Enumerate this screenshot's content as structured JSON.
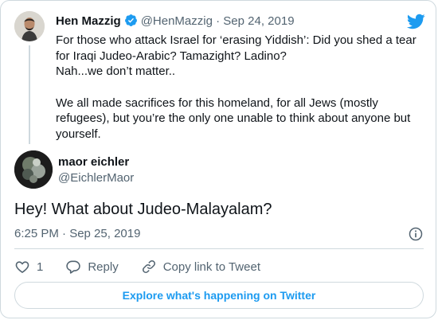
{
  "quoted_tweet": {
    "author_name": "Hen Mazzig",
    "author_handle": "@HenMazzig",
    "separator": "·",
    "date": "Sep 24, 2019",
    "lines": [
      "For those who attack Israel for ‘erasing Yiddish’: Did you shed a tear for Iraqi Judeo-Arabic? Tamazight? Ladino?",
      "Nah...we don’t matter..",
      "We all made sacrifices for this homeland, for all Jews (mostly refugees), but you’re the only one unable to think about anyone but yourself."
    ]
  },
  "reply_tweet": {
    "author_name": "maor eichler",
    "author_handle": "@EichlerMaor",
    "text": "Hey! What about Judeo-Malayalam?",
    "timestamp": "6:25 PM · Sep 25, 2019"
  },
  "actions": {
    "like_count": "1",
    "reply_label": "Reply",
    "copy_link_label": "Copy link to Tweet"
  },
  "explore_label": "Explore what's happening on Twitter",
  "colors": {
    "twitter_blue": "#1d9bf0",
    "muted_text": "#536471",
    "border": "#cfd9de"
  },
  "icons": [
    "twitter-bird-icon",
    "verified-badge-icon",
    "info-icon",
    "heart-icon",
    "reply-icon",
    "link-icon"
  ]
}
